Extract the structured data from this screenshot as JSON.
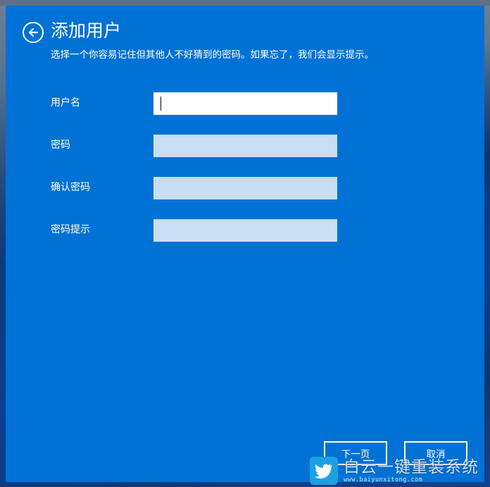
{
  "header": {
    "title": "添加用户",
    "subtitle": "选择一个你容易记住但其他人不好猜到的密码。如果忘了，我们会显示提示。"
  },
  "fields": [
    {
      "label": "用户名",
      "value": "",
      "active": true
    },
    {
      "label": "密码",
      "value": ""
    },
    {
      "label": "确认密码",
      "value": ""
    },
    {
      "label": "密码提示",
      "value": ""
    }
  ],
  "buttons": {
    "next": "下一页",
    "cancel": "取消"
  },
  "watermark": {
    "title": "白云一键重装系统",
    "url": "www.baiyunxitong.com"
  },
  "colors": {
    "dialog_bg": "#0072d6",
    "input_bg": "#c8def4",
    "active_input_bg": "#ffffff"
  },
  "icons": {
    "back": "back-arrow-circle-icon",
    "watermark_logo": "bird-logo-icon"
  }
}
